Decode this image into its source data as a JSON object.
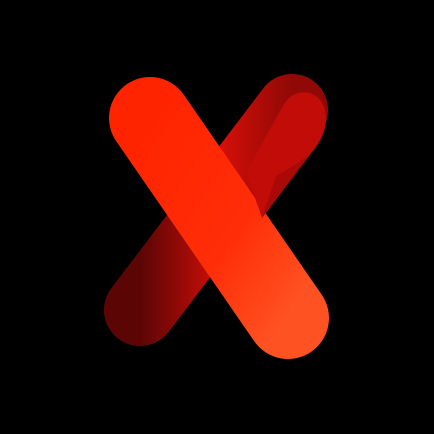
{
  "icon": {
    "name": "x-logo-icon",
    "background_color": "#000000",
    "colors": {
      "front_stroke_light": "#ff2a00",
      "front_stroke_dark": "#ff4a1a",
      "back_stroke_light": "#e0120a",
      "back_stroke_dark": "#8e0808"
    }
  }
}
